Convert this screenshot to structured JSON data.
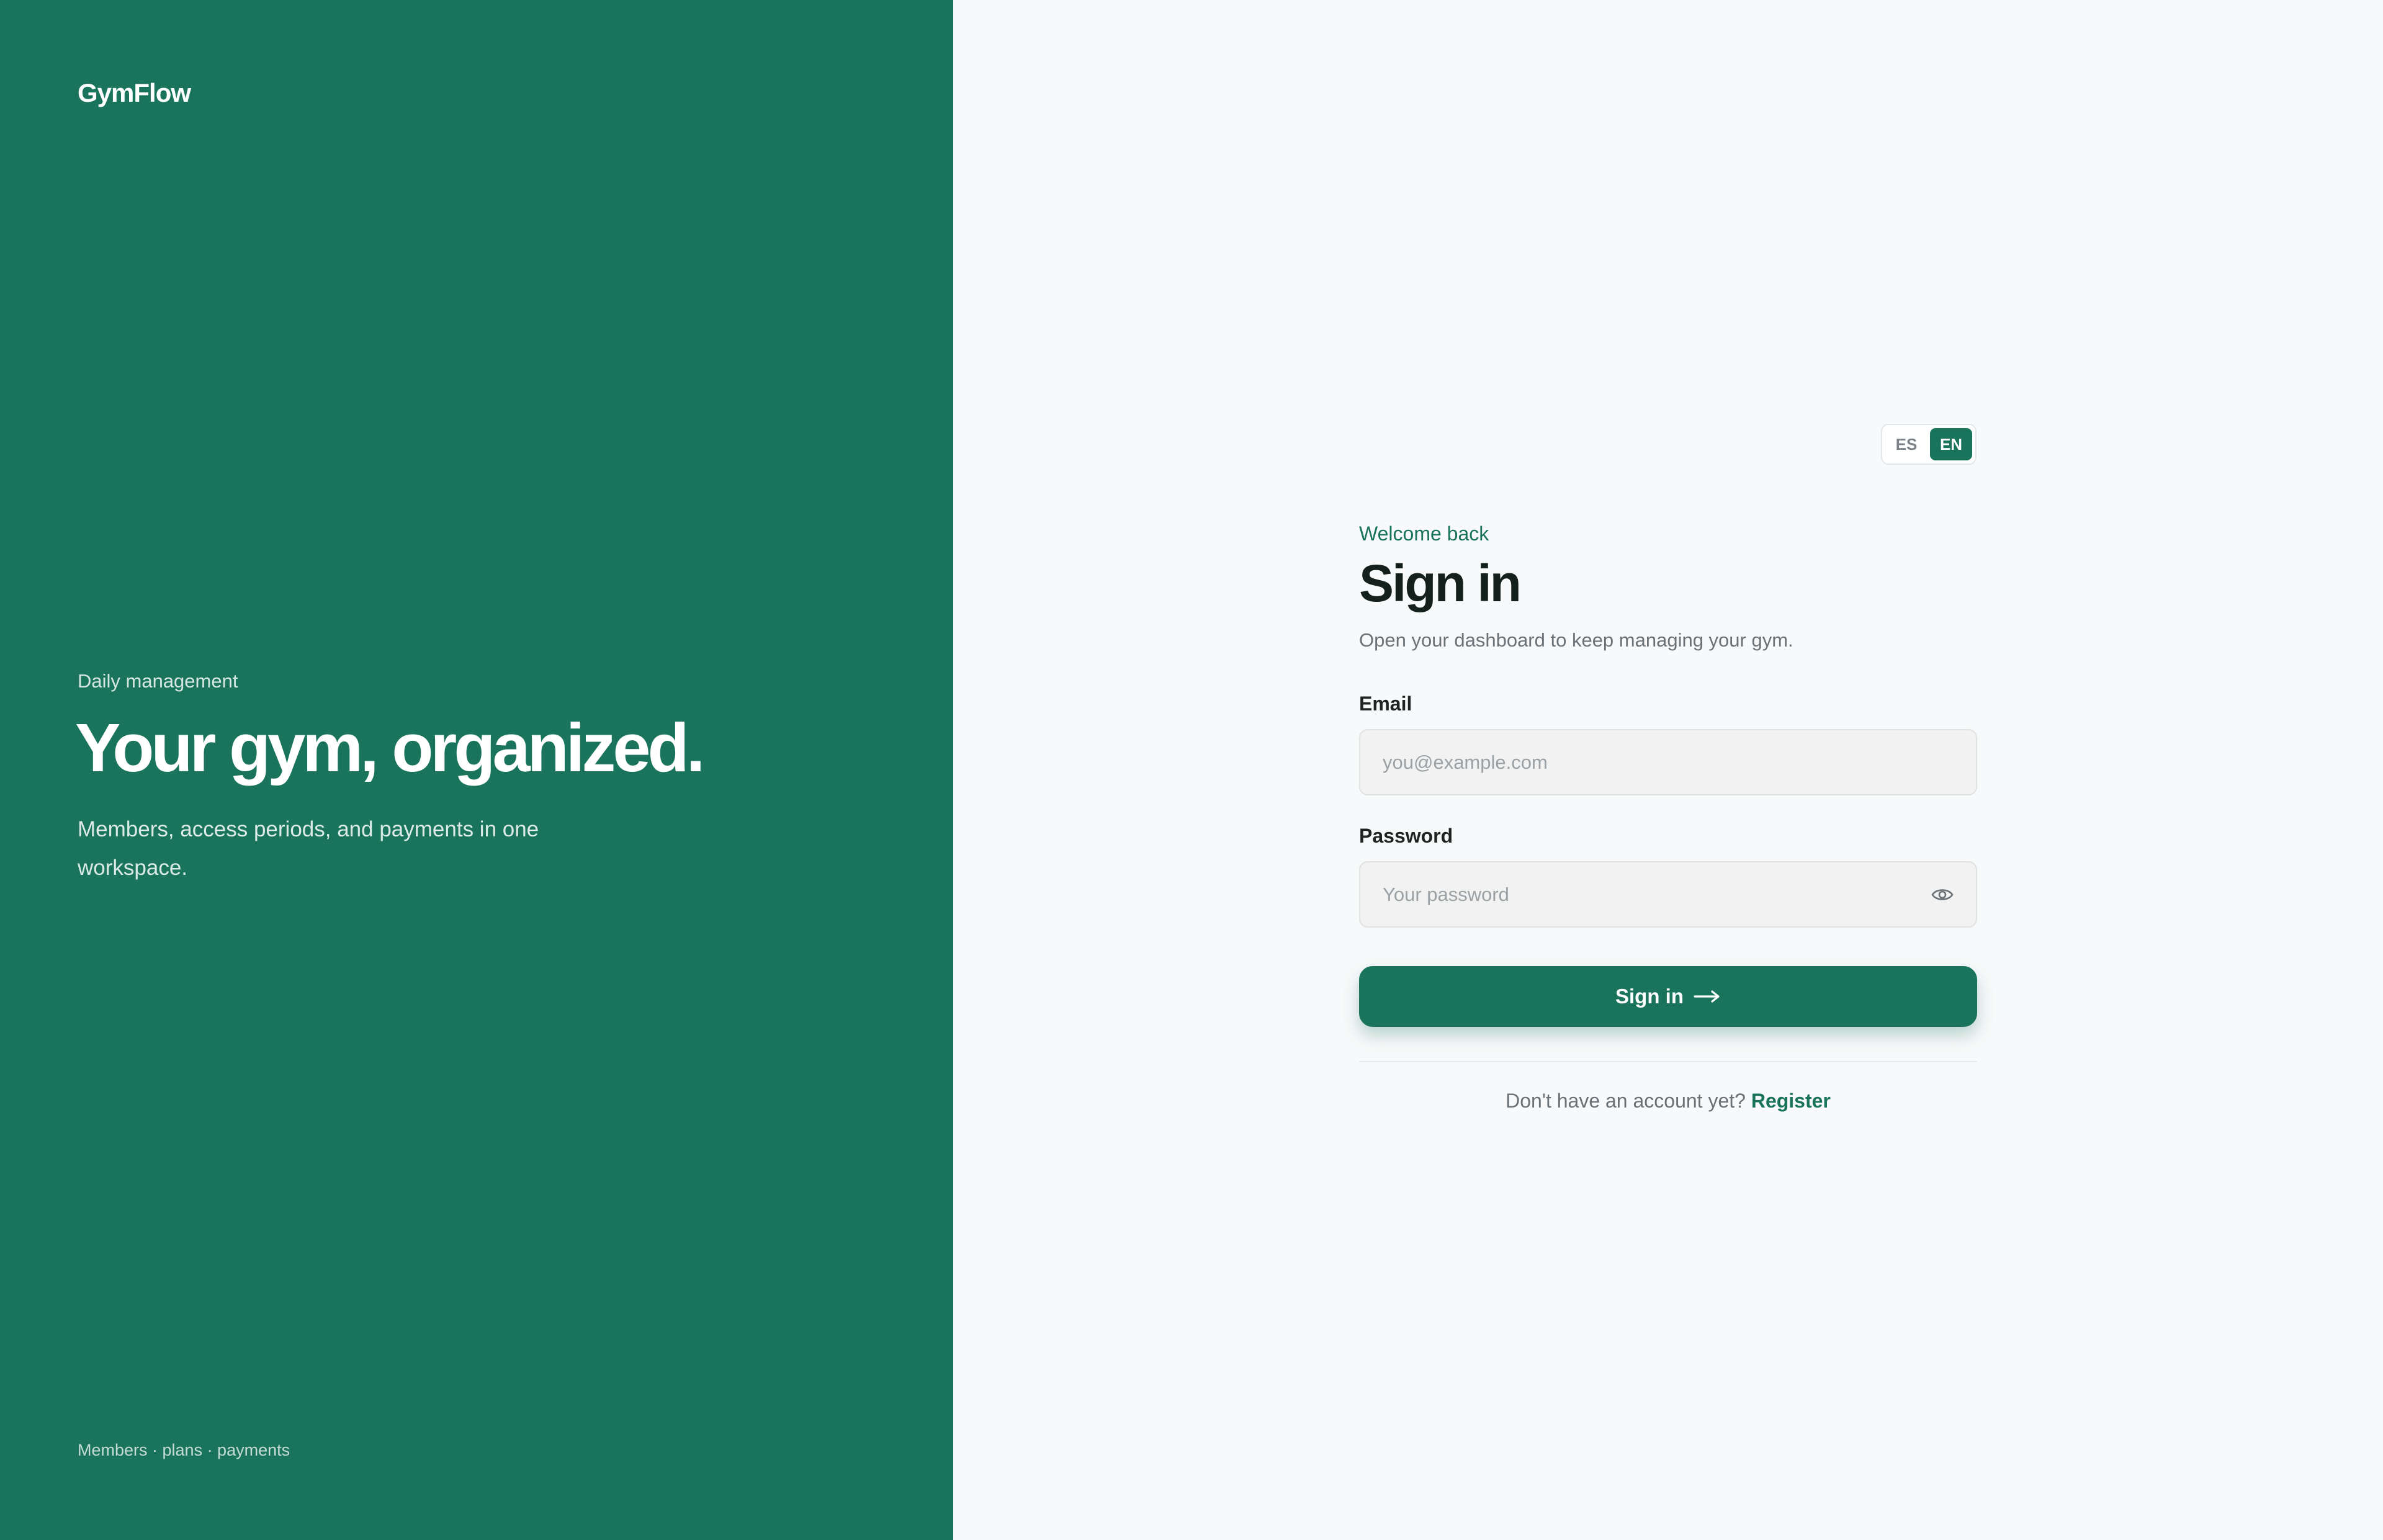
{
  "brand": {
    "logo": "GymFlow",
    "eyebrow": "Daily management",
    "headline": "Your gym, organized.",
    "subtitle": "Members, access periods, and payments in one workspace.",
    "footer": "Members · plans · payments"
  },
  "language_switch": {
    "options": [
      "ES",
      "EN"
    ],
    "selected": "EN"
  },
  "form": {
    "eyebrow": "Welcome back",
    "title": "Sign in",
    "subtitle": "Open your dashboard to keep managing your gym.",
    "email_label": "Email",
    "email_placeholder": "you@example.com",
    "email_value": "",
    "password_label": "Password",
    "password_placeholder": "Your password",
    "password_value": "",
    "password_toggle_icon": "eye-icon",
    "submit_label": "Sign in",
    "submit_icon": "arrow-right-icon",
    "register_prompt": "Don't have an account yet?",
    "register_link": "Register"
  },
  "colors": {
    "accent": "#19745b",
    "left_panel_bg": "#19745b",
    "right_panel_bg": "#f8f9fa",
    "title_text": "#14201b",
    "muted_text": "#6a7177"
  }
}
